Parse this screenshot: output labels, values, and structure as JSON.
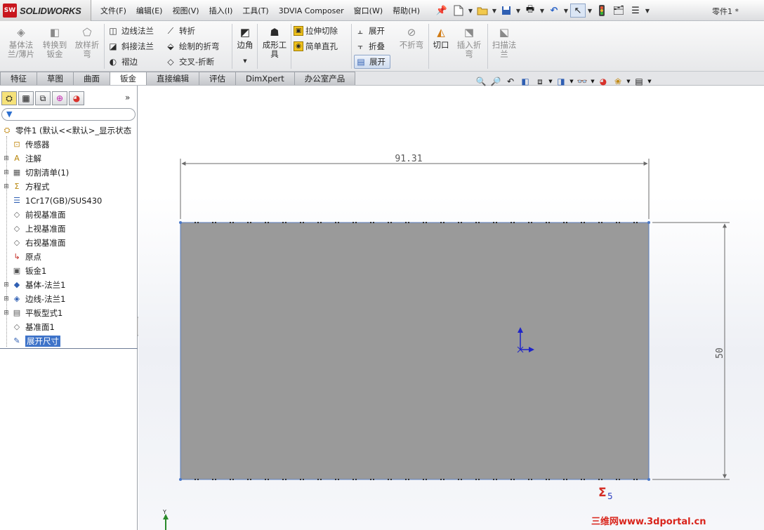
{
  "app": {
    "logo_mark": "SW",
    "logo_text": "SOLIDWORKS",
    "doc_title": "零件1 *"
  },
  "menu": [
    "文件(F)",
    "编辑(E)",
    "视图(V)",
    "插入(I)",
    "工具(T)",
    "3DVIA Composer",
    "窗口(W)",
    "帮助(H)"
  ],
  "quick_access": [
    "pin-icon",
    "new-document-icon",
    "open-icon",
    "save-icon",
    "print-icon",
    "undo-icon",
    "select-icon",
    "rebuild-icon",
    "file-properties-icon",
    "options-icon"
  ],
  "commands": {
    "base_flange": "基体法\n兰/薄片",
    "convert_to_sheet": "转换到\n钣金",
    "lofted_bend": "放样折\n弯",
    "edge_flange": "边线法兰",
    "miter_flange": "斜接法兰",
    "hem": "褶边",
    "jog": "转折",
    "sketched_bend": "绘制的折弯",
    "cross_break": "交叉-折断",
    "corners": "边角",
    "forming_tool": "成形工\n具",
    "extruded_cut": "拉伸切除",
    "simple_hole": "简单直孔",
    "unfold": "展开",
    "fold": "折叠",
    "flatten": "展开",
    "no_bends": "不折弯",
    "rip": "切口",
    "insert_bends": "插入折\n弯",
    "swept_flange": "扫描法\n兰"
  },
  "tabs": [
    "特征",
    "草图",
    "曲面",
    "钣金",
    "直接编辑",
    "评估",
    "DimXpert",
    "办公室产品"
  ],
  "active_tab": "钣金",
  "hud_icons": [
    "zoom-to-fit-icon",
    "zoom-area-icon",
    "previous-view-icon",
    "section-view-icon",
    "view-orientation-icon",
    "display-style-icon",
    "hide-show-icon",
    "appearance-icon",
    "scene-icon",
    "view-settings-icon"
  ],
  "feature_tree": {
    "root": "零件1  (默认<<默认>_显示状态",
    "items": [
      {
        "label": "传感器",
        "icon": "sensor-icon",
        "expandable": false
      },
      {
        "label": "注解",
        "icon": "annotations-icon",
        "expandable": true
      },
      {
        "label": "切割清单(1)",
        "icon": "cut-list-icon",
        "expandable": true
      },
      {
        "label": "方程式",
        "icon": "equations-icon",
        "expandable": true
      },
      {
        "label": "1Cr17(GB)/SUS430",
        "icon": "material-icon",
        "expandable": false
      },
      {
        "label": "前视基准面",
        "icon": "plane-icon",
        "expandable": false
      },
      {
        "label": "上视基准面",
        "icon": "plane-icon",
        "expandable": false
      },
      {
        "label": "右视基准面",
        "icon": "plane-icon",
        "expandable": false
      },
      {
        "label": "原点",
        "icon": "origin-icon",
        "expandable": false
      },
      {
        "label": "钣金1",
        "icon": "sheet-metal-icon",
        "expandable": false
      },
      {
        "label": "基体-法兰1",
        "icon": "base-flange-icon",
        "expandable": true
      },
      {
        "label": "边线-法兰1",
        "icon": "edge-flange-icon",
        "expandable": true
      },
      {
        "label": "平板型式1",
        "icon": "flat-pattern-icon",
        "expandable": true
      },
      {
        "label": "基准面1",
        "icon": "plane-icon",
        "expandable": false
      },
      {
        "label": "展开尺寸",
        "icon": "sketch-icon",
        "expandable": false,
        "selected": true
      }
    ]
  },
  "drawing": {
    "width_dim": "91.31",
    "height_dim": "50",
    "sum_symbol": "Σ",
    "sum_subscript": "5",
    "triad_y": "Y",
    "part_color": "#9a9a9a",
    "dim_color": "#6b6b6b",
    "triad_color": "#1f24c8"
  },
  "watermark": "三维网www.3dportal.cn"
}
